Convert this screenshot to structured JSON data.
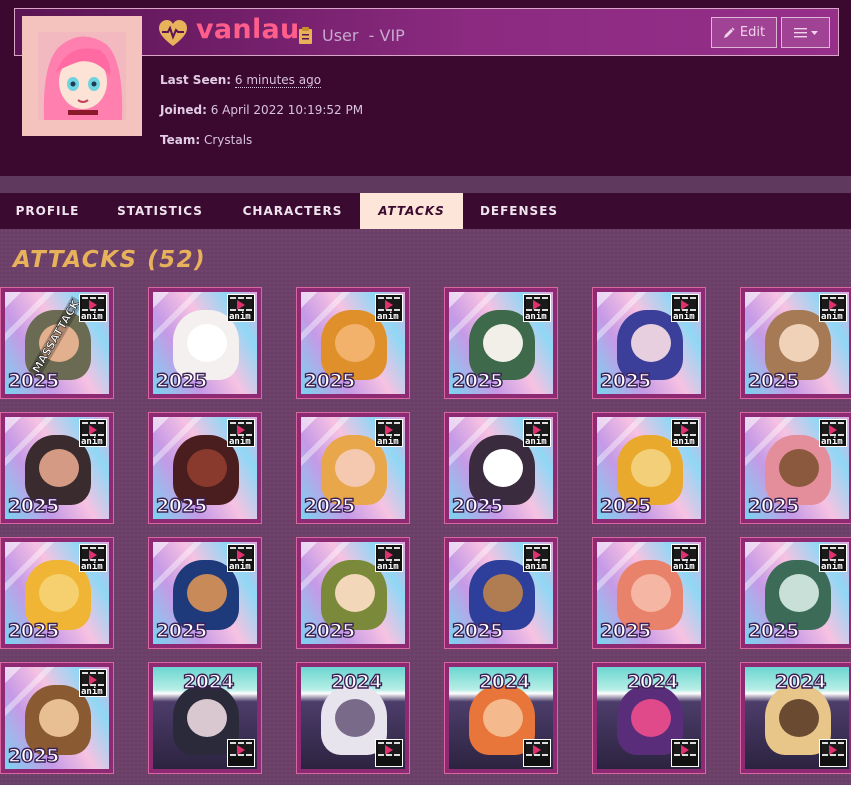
{
  "profile": {
    "username": "vanlau",
    "role": "User",
    "membership": "- VIP",
    "edit_label": "Edit",
    "last_seen_label": "Last Seen:",
    "last_seen_value": "6 minutes ago",
    "joined_label": "Joined:",
    "joined_value": "6 April 2022 10:19:52 PM",
    "team_label": "Team:",
    "team_value": "Crystals",
    "heart_icon": "heart-pulse-icon",
    "role_icon": "clipboard-icon",
    "menu_icon": "hamburger-icon",
    "colors": {
      "username": "#ff5d8a",
      "banner": "#8b2a80",
      "accent_gold": "#e8b25a"
    }
  },
  "tabs": [
    {
      "label": "PROFILE",
      "active": false
    },
    {
      "label": "STATISTICS",
      "active": false
    },
    {
      "label": "CHARACTERS",
      "active": false
    },
    {
      "label": "ATTACKS",
      "active": true
    },
    {
      "label": "DEFENSES",
      "active": false
    }
  ],
  "attacks": {
    "title": "ATTACKS (52)",
    "items": [
      {
        "year": "2025",
        "anim": true,
        "badge": "MASSATTACK",
        "palette": [
          "#6b6b53",
          "#e2b08f"
        ]
      },
      {
        "year": "2025",
        "anim": true,
        "badge": "",
        "palette": [
          "#f4f0ef",
          "#ffffff"
        ]
      },
      {
        "year": "2025",
        "anim": true,
        "badge": "",
        "palette": [
          "#e0902a",
          "#f2b26b"
        ]
      },
      {
        "year": "2025",
        "anim": true,
        "badge": "",
        "palette": [
          "#3e6a4b",
          "#f1efe8"
        ]
      },
      {
        "year": "2025",
        "anim": true,
        "badge": "",
        "palette": [
          "#3b3f9a",
          "#e8cfe0"
        ]
      },
      {
        "year": "2025",
        "anim": true,
        "badge": "",
        "palette": [
          "#a57a55",
          "#f0d2b8"
        ]
      },
      {
        "year": "2025",
        "anim": true,
        "badge": "",
        "palette": [
          "#3a2b2e",
          "#d59a84"
        ]
      },
      {
        "year": "2025",
        "anim": true,
        "badge": "",
        "palette": [
          "#4a1e1e",
          "#8a3a2c"
        ]
      },
      {
        "year": "2025",
        "anim": true,
        "badge": "",
        "palette": [
          "#e7a74a",
          "#f5c8b0"
        ]
      },
      {
        "year": "2025",
        "anim": true,
        "badge": "",
        "palette": [
          "#3a2c3e",
          "#ffffff"
        ]
      },
      {
        "year": "2025",
        "anim": true,
        "badge": "",
        "palette": [
          "#e8a92c",
          "#f4cf7a"
        ]
      },
      {
        "year": "2025",
        "anim": true,
        "badge": "",
        "palette": [
          "#e58e9b",
          "#8b5a3e"
        ]
      },
      {
        "year": "2025",
        "anim": true,
        "badge": "",
        "palette": [
          "#f0b534",
          "#f6d06e"
        ]
      },
      {
        "year": "2025",
        "anim": true,
        "badge": "",
        "palette": [
          "#1f3a7a",
          "#c98a5a"
        ]
      },
      {
        "year": "2025",
        "anim": true,
        "badge": "",
        "palette": [
          "#7a8a3a",
          "#f2d8b8"
        ]
      },
      {
        "year": "2025",
        "anim": true,
        "badge": "",
        "palette": [
          "#2d3f9a",
          "#b07c52"
        ]
      },
      {
        "year": "2025",
        "anim": true,
        "badge": "",
        "palette": [
          "#e9826a",
          "#f6b6a4"
        ]
      },
      {
        "year": "2025",
        "anim": true,
        "badge": "",
        "palette": [
          "#3c6b58",
          "#c8e0d8"
        ]
      },
      {
        "year": "2025",
        "anim": true,
        "badge": "",
        "palette": [
          "#8a5a32",
          "#e8bf93"
        ]
      },
      {
        "year": "2024",
        "anim": true,
        "badge": "",
        "palette": [
          "#2b2a3a",
          "#d9c8d0"
        ]
      },
      {
        "year": "2024",
        "anim": true,
        "badge": "",
        "palette": [
          "#e8e4ee",
          "#7a6a8a"
        ]
      },
      {
        "year": "2024",
        "anim": true,
        "badge": "",
        "palette": [
          "#e8763a",
          "#f4b98d"
        ]
      },
      {
        "year": "2024",
        "anim": true,
        "badge": "",
        "palette": [
          "#5a2d7a",
          "#e04a8a"
        ]
      },
      {
        "year": "2024",
        "anim": true,
        "badge": "",
        "palette": [
          "#e8c68a",
          "#6a4a30"
        ]
      }
    ]
  }
}
